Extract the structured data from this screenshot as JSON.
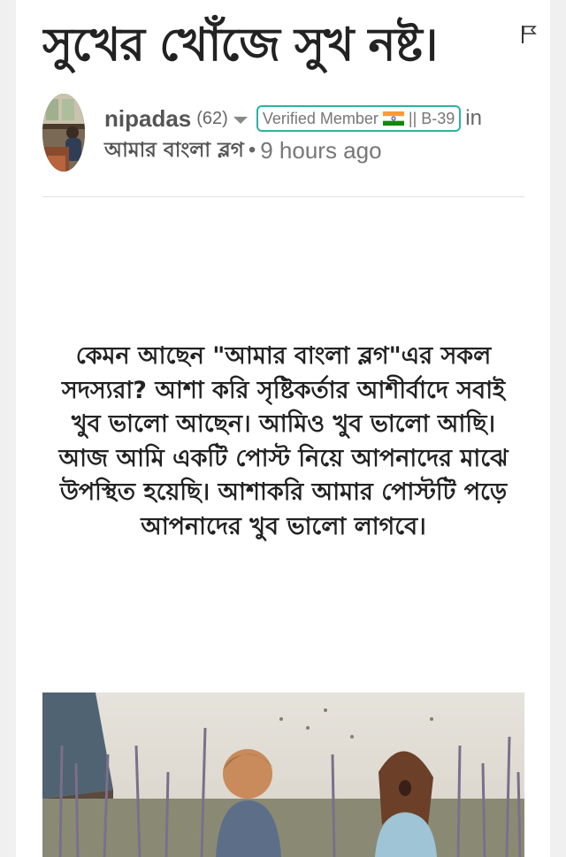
{
  "post": {
    "title": "সুখের খোঁজে সুখ নষ্ট।",
    "author": "nipadas",
    "reputation": "(62)",
    "badge_prefix": "Verified Member",
    "badge_suffix": "|| B-39",
    "in_label": "in",
    "community": "আমার বাংলা ব্লগ",
    "separator": "•",
    "time_ago": "9 hours ago",
    "body": "কেমন আছেন \"আমার বাংলা ব্লগ\"এর সকল সদস্যরা? আশা করি সৃষ্টিকর্তার আশীর্বাদে সবাই খুব ভালো আছেন। আমিও খুব ভালো আছি। আজ আমি একটি পোস্ট নিয়ে আপনাদের মাঝে উপস্থিত হয়েছি। আশাকরি আমার পোস্টটি পড়ে আপনাদের খুব ভালো লাগবে।"
  },
  "icons": {
    "flag": "flag-outline-icon",
    "caret": "caret-down-icon",
    "country_flag": "india-flag-icon"
  },
  "colors": {
    "badge_border": "#2bb3a0",
    "text_dark": "#222222",
    "text_meta": "#555555"
  }
}
